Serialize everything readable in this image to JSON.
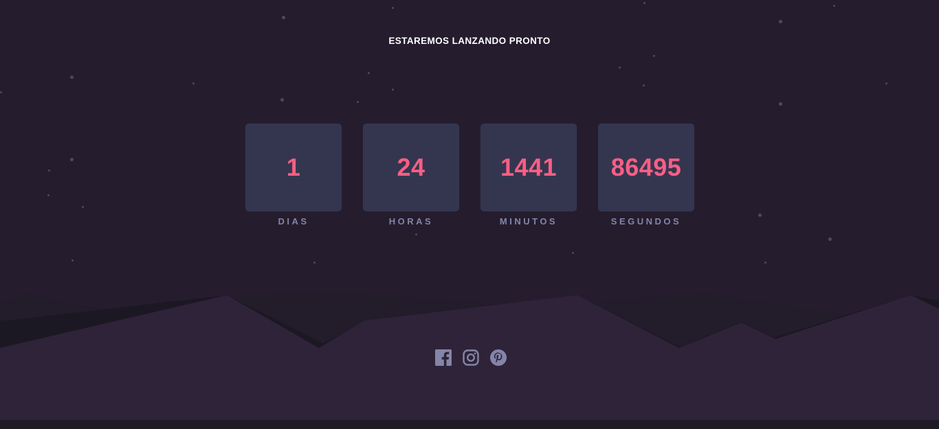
{
  "header": {
    "title": "ESTAREMOS LANZANDO PRONTO"
  },
  "countdown": {
    "units": [
      {
        "value": "1",
        "label": "DIAS"
      },
      {
        "value": "24",
        "label": "HORAS"
      },
      {
        "value": "1441",
        "label": "MINUTOS"
      },
      {
        "value": "86495",
        "label": "SEGUNDOS"
      }
    ]
  },
  "footer": {
    "socials": [
      {
        "icon": "facebook-icon"
      },
      {
        "icon": "instagram-icon"
      },
      {
        "icon": "pinterest-icon"
      }
    ]
  },
  "colors": {
    "background": "#251d2e",
    "card": "#343650",
    "accent": "#fb5e84",
    "label": "#8385a9",
    "hill_front": "#2f2339",
    "social_icon": "#8385a9"
  }
}
